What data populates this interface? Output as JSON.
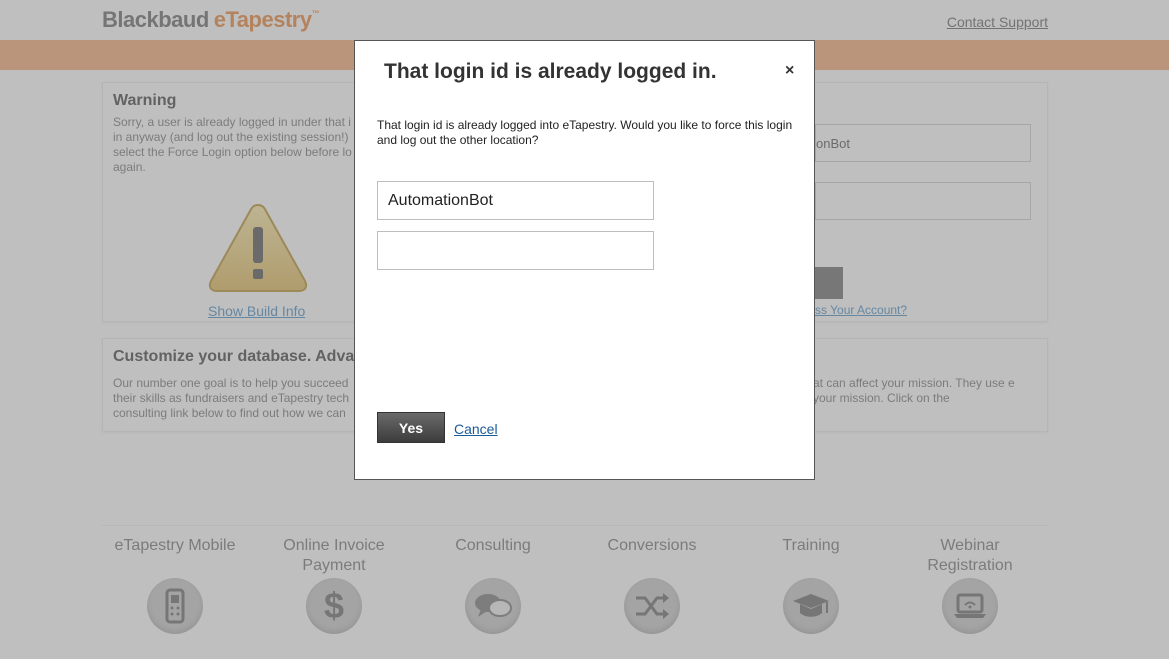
{
  "header": {
    "logo_part1": "Blackbaud",
    "logo_part2": "eTapestry",
    "logo_tm": "™",
    "contact_label": "Contact Support"
  },
  "warning_panel": {
    "title": "Warning",
    "text": "Sorry, a user is already logged in under that i in anyway (and log out the existing session!) select the Force Login option below before lo again.",
    "build_info_label": "Show Build Info",
    "bg_username_value": "onBot",
    "login_button_label": "n",
    "forgot_label": "ss Your Account?"
  },
  "customize_panel": {
    "title": "Customize your database. Advanc",
    "text_left": "Our number one goal is to help you succeed their skills as fundraisers and eTapestry tech consulting link below to find out how we can",
    "text_right": "at can affect your mission. They use e your mission. Click on the"
  },
  "tiles": [
    {
      "label": "eTapestry Mobile",
      "icon": "mobile-phone-icon"
    },
    {
      "label": "Online Invoice Payment",
      "icon": "dollar-icon"
    },
    {
      "label": "Consulting",
      "icon": "chat-bubbles-icon"
    },
    {
      "label": "Conversions",
      "icon": "shuffle-icon"
    },
    {
      "label": "Training",
      "icon": "graduation-cap-icon"
    },
    {
      "label": "Webinar Registration",
      "icon": "laptop-icon"
    }
  ],
  "modal": {
    "title": "That login id is already logged in.",
    "close_glyph": "×",
    "message": "That login id is already logged into eTapestry. Would you like to force this login and log out the other location?",
    "username_value": "AutomationBot",
    "password_value": "",
    "yes_label": "Yes",
    "cancel_label": "Cancel"
  },
  "colors": {
    "brand_orange": "#e9873c",
    "band_orange": "#f5a877",
    "link_blue": "#1a5a99"
  }
}
